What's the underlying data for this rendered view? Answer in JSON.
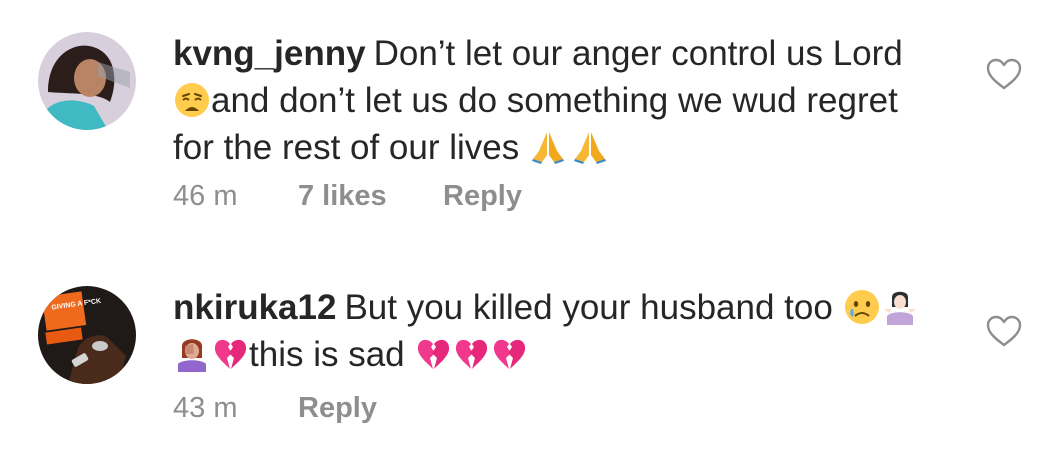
{
  "comments": [
    {
      "username": "kvng_jenny",
      "line1": "Don’t let our anger control us Lord",
      "line2": "and don’t let us do something we wud regret",
      "line3": "for the rest of our lives",
      "time": "46 m",
      "likes": "7 likes",
      "reply": "Reply"
    },
    {
      "username": "nkiruka12",
      "line1": "But you killed your husband too",
      "line2": "this is sad",
      "time": "43 m",
      "reply": "Reply",
      "avatar_text": "GIVING A F*CK"
    }
  ],
  "icons": {
    "like": "heart-outline-icon",
    "emoji1": "weary-face",
    "emoji2": "folded-hands",
    "emoji3": "crying-face",
    "emoji4": "person-shrugging",
    "emoji5": "person-facepalming",
    "emoji6": "broken-heart"
  },
  "colors": {
    "text": "#262626",
    "meta": "#8e8e8e",
    "broken_heart": "#f0398c"
  }
}
